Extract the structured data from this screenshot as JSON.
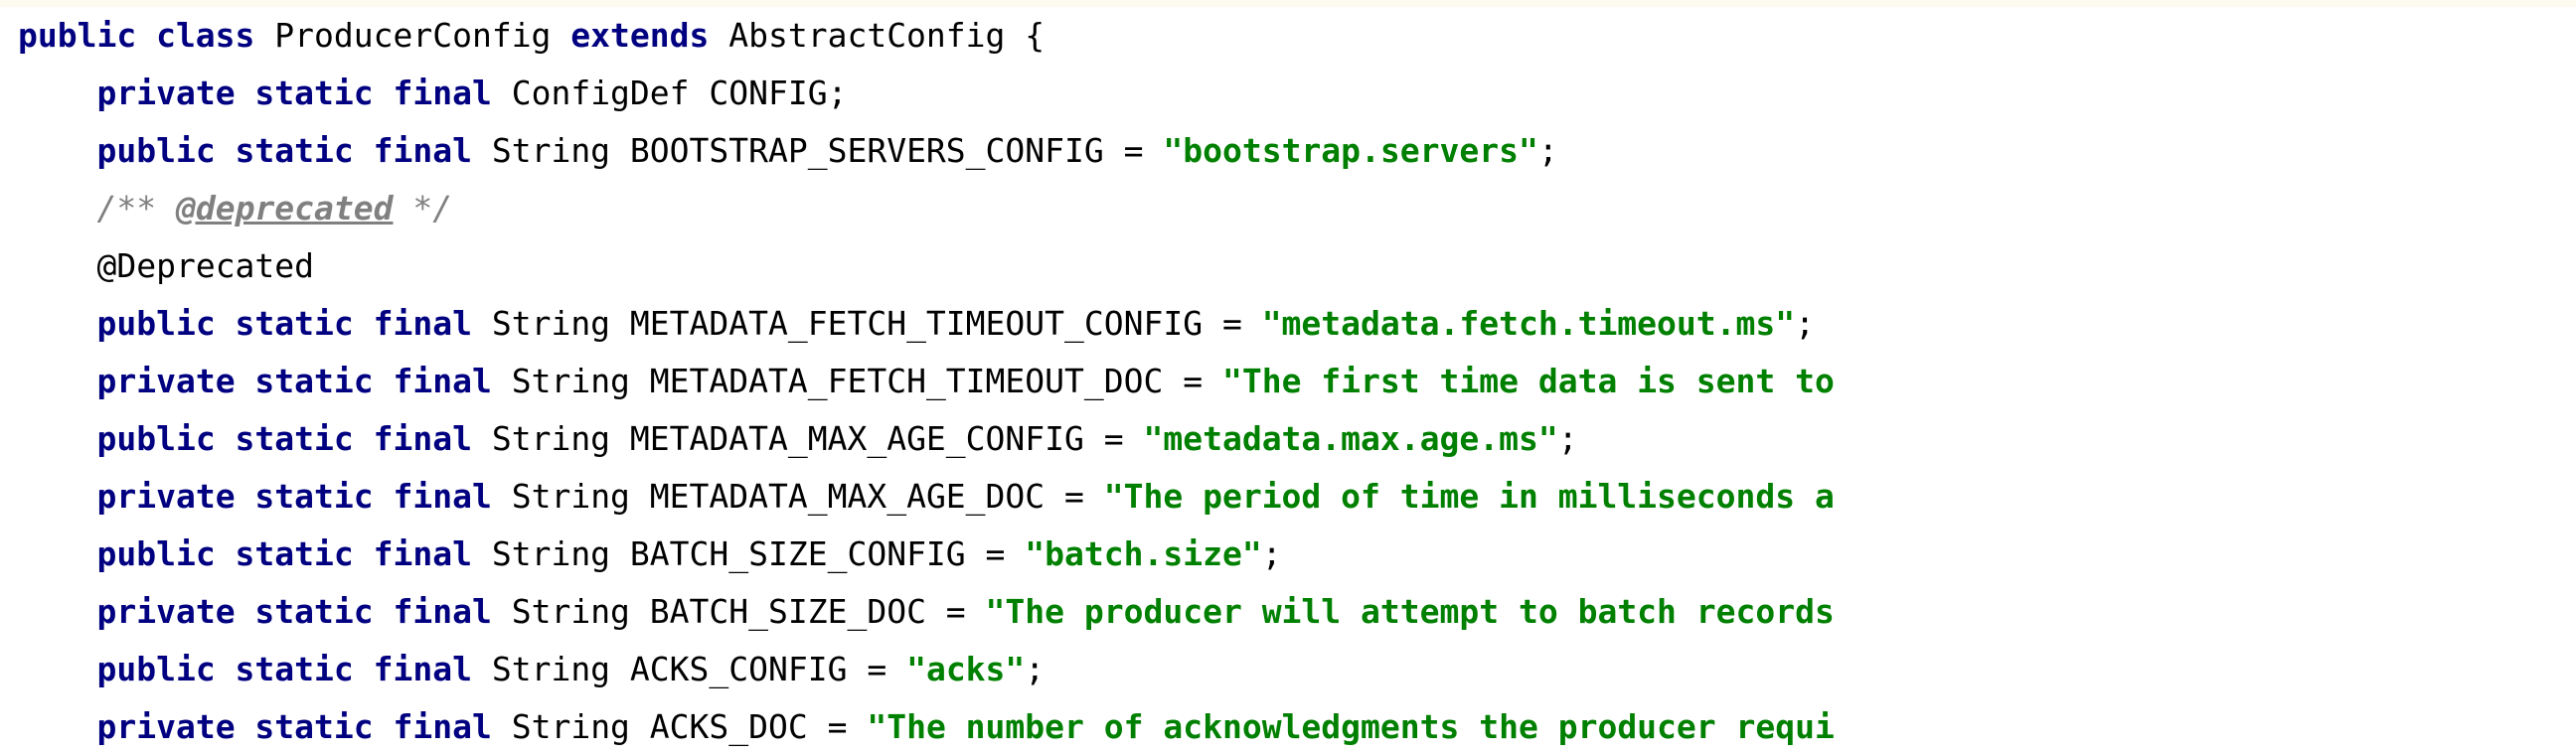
{
  "code_block": {
    "language": "java",
    "colors": {
      "background": "#ffffff",
      "top_strip": "#fdfbef",
      "keyword": "#000080",
      "plain": "#000000",
      "string": "#008000",
      "comment": "#808080"
    },
    "lines": [
      {
        "index": 1,
        "text": "public class ProducerConfig extends AbstractConfig {",
        "tokens": [
          {
            "kind": "kw",
            "text": "public class "
          },
          {
            "kind": "plain",
            "text": "ProducerConfig "
          },
          {
            "kind": "kw",
            "text": "extends "
          },
          {
            "kind": "plain",
            "text": "AbstractConfig {"
          }
        ]
      },
      {
        "index": 2,
        "text": "    private static final ConfigDef CONFIG;",
        "tokens": [
          {
            "kind": "plain",
            "text": "    "
          },
          {
            "kind": "kw",
            "text": "private static final "
          },
          {
            "kind": "plain",
            "text": "ConfigDef CONFIG;"
          }
        ]
      },
      {
        "index": 3,
        "text": "    public static final String BOOTSTRAP_SERVERS_CONFIG = \"bootstrap.servers\";",
        "tokens": [
          {
            "kind": "plain",
            "text": "    "
          },
          {
            "kind": "kw",
            "text": "public static final "
          },
          {
            "kind": "plain",
            "text": "String BOOTSTRAP_SERVERS_CONFIG = "
          },
          {
            "kind": "str",
            "text": "\"bootstrap.servers\""
          },
          {
            "kind": "plain",
            "text": ";"
          }
        ]
      },
      {
        "index": 4,
        "text": "    /** @deprecated */",
        "tokens": [
          {
            "kind": "plain",
            "text": "    "
          },
          {
            "kind": "comment",
            "text": "/** "
          },
          {
            "kind": "comment-tag",
            "text": "@deprecated"
          },
          {
            "kind": "comment",
            "text": " */"
          }
        ]
      },
      {
        "index": 5,
        "text": "    @Deprecated",
        "tokens": [
          {
            "kind": "plain",
            "text": "    "
          },
          {
            "kind": "annot",
            "text": "@Deprecated"
          }
        ]
      },
      {
        "index": 6,
        "text": "    public static final String METADATA_FETCH_TIMEOUT_CONFIG = \"metadata.fetch.timeout.ms\";",
        "tokens": [
          {
            "kind": "plain",
            "text": "    "
          },
          {
            "kind": "kw",
            "text": "public static final "
          },
          {
            "kind": "plain",
            "text": "String METADATA_FETCH_TIMEOUT_CONFIG = "
          },
          {
            "kind": "str",
            "text": "\"metadata.fetch.timeout.ms\""
          },
          {
            "kind": "plain",
            "text": ";"
          }
        ]
      },
      {
        "index": 7,
        "text": "    private static final String METADATA_FETCH_TIMEOUT_DOC = \"The first time data is sent to",
        "tokens": [
          {
            "kind": "plain",
            "text": "    "
          },
          {
            "kind": "kw",
            "text": "private static final "
          },
          {
            "kind": "plain",
            "text": "String METADATA_FETCH_TIMEOUT_DOC = "
          },
          {
            "kind": "str",
            "text": "\"The first time data is sent to"
          }
        ]
      },
      {
        "index": 8,
        "text": "    public static final String METADATA_MAX_AGE_CONFIG = \"metadata.max.age.ms\";",
        "tokens": [
          {
            "kind": "plain",
            "text": "    "
          },
          {
            "kind": "kw",
            "text": "public static final "
          },
          {
            "kind": "plain",
            "text": "String METADATA_MAX_AGE_CONFIG = "
          },
          {
            "kind": "str",
            "text": "\"metadata.max.age.ms\""
          },
          {
            "kind": "plain",
            "text": ";"
          }
        ]
      },
      {
        "index": 9,
        "text": "    private static final String METADATA_MAX_AGE_DOC = \"The period of time in milliseconds a",
        "tokens": [
          {
            "kind": "plain",
            "text": "    "
          },
          {
            "kind": "kw",
            "text": "private static final "
          },
          {
            "kind": "plain",
            "text": "String METADATA_MAX_AGE_DOC = "
          },
          {
            "kind": "str",
            "text": "\"The period of time in milliseconds a"
          }
        ]
      },
      {
        "index": 10,
        "text": "    public static final String BATCH_SIZE_CONFIG = \"batch.size\";",
        "tokens": [
          {
            "kind": "plain",
            "text": "    "
          },
          {
            "kind": "kw",
            "text": "public static final "
          },
          {
            "kind": "plain",
            "text": "String BATCH_SIZE_CONFIG = "
          },
          {
            "kind": "str",
            "text": "\"batch.size\""
          },
          {
            "kind": "plain",
            "text": ";"
          }
        ]
      },
      {
        "index": 11,
        "text": "    private static final String BATCH_SIZE_DOC = \"The producer will attempt to batch records",
        "tokens": [
          {
            "kind": "plain",
            "text": "    "
          },
          {
            "kind": "kw",
            "text": "private static final "
          },
          {
            "kind": "plain",
            "text": "String BATCH_SIZE_DOC = "
          },
          {
            "kind": "str",
            "text": "\"The producer will attempt to batch records"
          }
        ]
      },
      {
        "index": 12,
        "text": "    public static final String ACKS_CONFIG = \"acks\";",
        "tokens": [
          {
            "kind": "plain",
            "text": "    "
          },
          {
            "kind": "kw",
            "text": "public static final "
          },
          {
            "kind": "plain",
            "text": "String ACKS_CONFIG = "
          },
          {
            "kind": "str",
            "text": "\"acks\""
          },
          {
            "kind": "plain",
            "text": ";"
          }
        ]
      },
      {
        "index": 13,
        "text": "    private static final String ACKS_DOC = \"The number of acknowledgments the producer requi",
        "tokens": [
          {
            "kind": "plain",
            "text": "    "
          },
          {
            "kind": "kw",
            "text": "private static final "
          },
          {
            "kind": "plain",
            "text": "String ACKS_DOC = "
          },
          {
            "kind": "str",
            "text": "\"The number of acknowledgments the producer requi"
          }
        ]
      }
    ]
  }
}
